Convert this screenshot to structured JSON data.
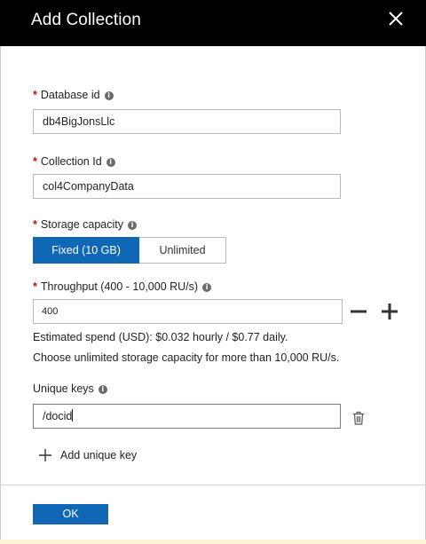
{
  "header": {
    "title": "Add Collection",
    "close_icon": "close-icon"
  },
  "form": {
    "database_id": {
      "required": "*",
      "label": "Database id",
      "info": "i",
      "value": "db4BigJonsLlc"
    },
    "collection_id": {
      "required": "*",
      "label": "Collection Id",
      "info": "i",
      "value": "col4CompanyData"
    },
    "storage": {
      "required": "*",
      "label": "Storage capacity",
      "info": "i",
      "options": [
        "Fixed (10 GB)",
        "Unlimited"
      ],
      "selected": "Fixed (10 GB)"
    },
    "throughput": {
      "required": "*",
      "label": "Throughput (400 - 10,000 RU/s)",
      "info": "i",
      "value": "400",
      "decrement_icon": "minus-icon",
      "increment_icon": "plus-icon"
    },
    "estimated_spend": "Estimated spend (USD): $0.032 hourly / $0.77 daily.",
    "unlimited_hint": "Choose unlimited storage capacity for more than 10,000 RU/s.",
    "unique_keys": {
      "label": "Unique keys",
      "info": "i",
      "value": "/docid",
      "delete_icon": "trash-icon",
      "add_label": "Add unique key",
      "add_icon": "plus-icon"
    }
  },
  "footer": {
    "ok_label": "OK"
  },
  "colors": {
    "header_bg": "#000000",
    "accent": "#1067b6",
    "required": "#c50f1f"
  }
}
